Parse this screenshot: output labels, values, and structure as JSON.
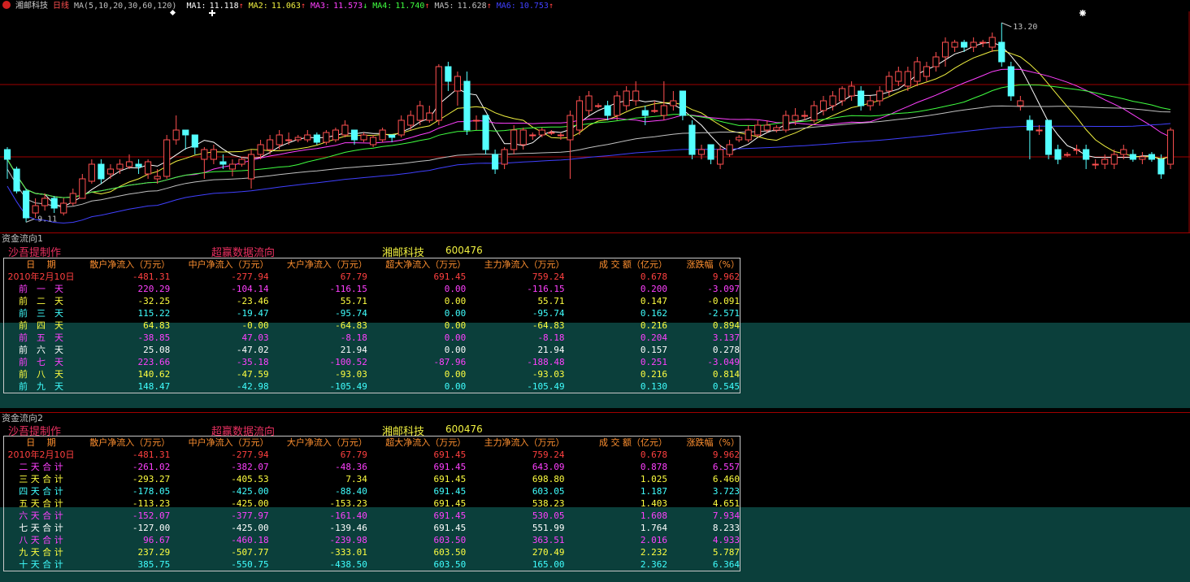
{
  "header": {
    "stock_name": "湘邮科技",
    "period": "日线",
    "ma_params": "MA(5,10,20,30,60,120)",
    "ma": [
      {
        "label": "MA1:",
        "value": "11.118",
        "arrow": "↑",
        "color": "#ffffff"
      },
      {
        "label": "MA2:",
        "value": "11.063",
        "arrow": "↑",
        "color": "#f0f040"
      },
      {
        "label": "MA3:",
        "value": "11.573",
        "arrow": "↓",
        "color": "#ff40ff"
      },
      {
        "label": "MA4:",
        "value": "11.740",
        "arrow": "↑",
        "color": "#40ff40"
      },
      {
        "label": "MA5:",
        "value": "11.628",
        "arrow": "↑",
        "color": "#c0c0c0"
      },
      {
        "label": "MA6:",
        "value": "10.753",
        "arrow": "↑",
        "color": "#4040ff"
      }
    ]
  },
  "chart": {
    "high_label": "13.20",
    "low_label": "9.11",
    "colors": {
      "up": "#ff5050",
      "down": "#54ffff",
      "grid": "#a00000"
    }
  },
  "chart_data": {
    "type": "candlestick",
    "ylim": [
      9.0,
      13.3
    ],
    "high": 13.2,
    "low": 9.11,
    "candles": [
      [
        10.6,
        10.4,
        10.65,
        10.0
      ],
      [
        10.2,
        9.75,
        10.25,
        9.7
      ],
      [
        9.75,
        9.2,
        9.8,
        9.11
      ],
      [
        9.3,
        9.45,
        9.6,
        9.2
      ],
      [
        9.45,
        9.6,
        9.7,
        9.35
      ],
      [
        9.6,
        9.4,
        9.65,
        9.3
      ],
      [
        9.3,
        9.5,
        9.6,
        9.25
      ],
      [
        9.5,
        9.7,
        9.8,
        9.45
      ],
      [
        9.6,
        10.0,
        10.1,
        9.6
      ],
      [
        9.95,
        10.3,
        10.4,
        9.9
      ],
      [
        10.3,
        10.0,
        10.4,
        9.9
      ],
      [
        10.1,
        10.2,
        10.3,
        10.0
      ],
      [
        10.2,
        10.3,
        10.4,
        10.1
      ],
      [
        10.25,
        10.35,
        10.5,
        10.2
      ],
      [
        10.3,
        10.25,
        10.4,
        10.1
      ],
      [
        10.1,
        10.35,
        10.4,
        10.0
      ],
      [
        10.0,
        10.05,
        10.2,
        9.9
      ],
      [
        10.05,
        10.8,
        10.9,
        10.0
      ],
      [
        10.8,
        11.0,
        11.3,
        10.7
      ],
      [
        11.0,
        10.9,
        11.0,
        10.6
      ],
      [
        10.9,
        10.65,
        10.9,
        10.5
      ],
      [
        10.4,
        10.6,
        10.65,
        10.0
      ],
      [
        10.4,
        10.6,
        10.7,
        10.3
      ],
      [
        10.35,
        10.3,
        10.5,
        10.2
      ],
      [
        10.2,
        10.3,
        10.4,
        10.05
      ],
      [
        10.3,
        10.4,
        10.45,
        10.25
      ],
      [
        10.0,
        10.5,
        10.6,
        9.8
      ],
      [
        10.5,
        10.7,
        10.8,
        10.4
      ],
      [
        10.6,
        10.8,
        10.9,
        10.5
      ],
      [
        10.7,
        10.9,
        11.0,
        10.6
      ],
      [
        10.8,
        10.8,
        10.95,
        10.7
      ],
      [
        10.8,
        10.85,
        10.9,
        10.75
      ],
      [
        10.8,
        10.9,
        11.0,
        10.75
      ],
      [
        10.9,
        10.75,
        10.95,
        10.7
      ],
      [
        10.75,
        10.95,
        11.0,
        10.7
      ],
      [
        10.8,
        11.0,
        11.05,
        10.75
      ],
      [
        10.9,
        11.1,
        11.2,
        10.85
      ],
      [
        11.0,
        10.8,
        11.0,
        10.7
      ],
      [
        10.8,
        10.9,
        10.95,
        10.75
      ],
      [
        10.7,
        10.85,
        10.9,
        10.65
      ],
      [
        10.8,
        11.0,
        11.05,
        10.75
      ],
      [
        10.9,
        10.85,
        10.9,
        10.75
      ],
      [
        10.9,
        11.2,
        11.3,
        10.85
      ],
      [
        11.1,
        11.3,
        11.4,
        11.0
      ],
      [
        11.2,
        11.5,
        11.6,
        11.1
      ],
      [
        11.2,
        11.35,
        11.5,
        11.15
      ],
      [
        11.2,
        12.3,
        12.35,
        11.1
      ],
      [
        12.3,
        12.0,
        12.4,
        11.8
      ],
      [
        11.8,
        12.1,
        12.2,
        11.5
      ],
      [
        12.0,
        11.0,
        12.2,
        10.9
      ],
      [
        11.2,
        11.2,
        11.3,
        11.0
      ],
      [
        11.3,
        10.6,
        11.3,
        10.5
      ],
      [
        10.5,
        10.2,
        10.6,
        10.1
      ],
      [
        10.3,
        10.6,
        10.65,
        10.2
      ],
      [
        10.6,
        11.0,
        11.1,
        10.5
      ],
      [
        10.7,
        11.0,
        11.05,
        10.6
      ],
      [
        10.9,
        10.9,
        10.95,
        10.8
      ],
      [
        10.9,
        11.0,
        11.05,
        10.85
      ],
      [
        10.95,
        10.95,
        11.0,
        10.9
      ],
      [
        10.9,
        10.9,
        10.95,
        10.8
      ],
      [
        10.8,
        11.3,
        11.4,
        10.0
      ],
      [
        11.0,
        11.6,
        11.7,
        10.9
      ],
      [
        11.4,
        11.7,
        11.8,
        11.3
      ],
      [
        11.5,
        11.5,
        11.55,
        11.45
      ],
      [
        11.5,
        11.3,
        11.6,
        11.2
      ],
      [
        11.3,
        11.7,
        11.8,
        11.2
      ],
      [
        11.5,
        11.8,
        11.9,
        11.4
      ],
      [
        11.6,
        11.8,
        12.0,
        11.5
      ],
      [
        11.4,
        11.3,
        11.5,
        11.1
      ],
      [
        11.4,
        11.4,
        11.6,
        11.35
      ],
      [
        11.3,
        11.5,
        12.0,
        11.2
      ],
      [
        11.5,
        11.6,
        11.8,
        11.4
      ],
      [
        11.8,
        11.3,
        11.8,
        11.2
      ],
      [
        11.1,
        10.5,
        11.2,
        10.4
      ],
      [
        10.5,
        10.6,
        10.7,
        10.4
      ],
      [
        10.7,
        10.4,
        10.7,
        10.3
      ],
      [
        10.3,
        10.6,
        10.7,
        10.2
      ],
      [
        10.5,
        10.7,
        10.8,
        10.45
      ],
      [
        10.8,
        10.85,
        10.9,
        10.75
      ],
      [
        10.8,
        11.0,
        11.1,
        10.75
      ],
      [
        10.9,
        11.1,
        11.2,
        10.85
      ],
      [
        11.0,
        11.1,
        11.2,
        10.95
      ],
      [
        11.0,
        11.05,
        11.1,
        10.95
      ],
      [
        11.0,
        11.3,
        11.4,
        10.95
      ],
      [
        11.2,
        11.3,
        11.45,
        11.1
      ],
      [
        11.3,
        11.3,
        11.4,
        11.2
      ],
      [
        11.2,
        11.5,
        11.6,
        11.15
      ],
      [
        11.4,
        11.6,
        11.7,
        11.3
      ],
      [
        11.5,
        11.7,
        11.8,
        11.4
      ],
      [
        11.6,
        11.85,
        11.9,
        11.5
      ],
      [
        11.7,
        11.9,
        12.0,
        11.6
      ],
      [
        11.8,
        11.5,
        11.9,
        11.4
      ],
      [
        11.5,
        11.6,
        11.7,
        11.4
      ],
      [
        11.6,
        11.8,
        11.9,
        11.5
      ],
      [
        11.8,
        12.1,
        12.2,
        11.7
      ],
      [
        12.0,
        12.2,
        12.3,
        11.9
      ],
      [
        11.9,
        12.2,
        12.3,
        11.8
      ],
      [
        12.0,
        12.4,
        12.5,
        11.9
      ],
      [
        12.1,
        12.3,
        12.4,
        12.0
      ],
      [
        12.3,
        12.5,
        12.6,
        12.2
      ],
      [
        12.5,
        12.8,
        12.9,
        12.3
      ],
      [
        12.7,
        12.8,
        12.85,
        12.6
      ],
      [
        12.8,
        12.7,
        12.85,
        12.6
      ],
      [
        12.7,
        12.8,
        12.9,
        12.6
      ],
      [
        12.8,
        12.8,
        12.85,
        12.7
      ],
      [
        12.7,
        12.9,
        13.0,
        12.6
      ],
      [
        12.8,
        12.4,
        13.2,
        12.3
      ],
      [
        12.3,
        11.7,
        12.4,
        11.6
      ],
      [
        11.5,
        11.6,
        11.7,
        11.4
      ],
      [
        11.2,
        11.0,
        11.3,
        10.4
      ],
      [
        11.0,
        11.0,
        11.1,
        10.9
      ],
      [
        11.2,
        10.5,
        11.2,
        10.4
      ],
      [
        10.6,
        10.4,
        10.7,
        10.3
      ],
      [
        10.5,
        10.5,
        10.55,
        10.45
      ],
      [
        10.6,
        10.6,
        10.7,
        10.5
      ],
      [
        10.6,
        10.4,
        10.7,
        10.2
      ],
      [
        10.3,
        10.3,
        10.4,
        10.2
      ],
      [
        10.3,
        10.4,
        10.5,
        10.2
      ],
      [
        10.3,
        10.5,
        10.6,
        10.2
      ],
      [
        10.5,
        10.6,
        10.7,
        10.4
      ],
      [
        10.5,
        10.4,
        10.6,
        10.35
      ],
      [
        10.4,
        10.45,
        10.55,
        10.3
      ],
      [
        10.5,
        10.4,
        10.55,
        10.35
      ],
      [
        10.4,
        10.1,
        10.5,
        10.0
      ],
      [
        10.3,
        11.0,
        11.05,
        10.2
      ]
    ]
  },
  "panel1": {
    "title": "资金流向1",
    "author": "沙吾提制作",
    "heading": "超赢数据流向",
    "stock_label": "湘邮科技",
    "stock_code": "600476",
    "columns": [
      "日　 期",
      "散户净流入（万元）",
      "中户净流入（万元）",
      "大户净流入（万元）",
      "超大净流入（万元）",
      "主力净流入（万元）",
      "成 交 额（亿元）",
      "涨跌幅（%）"
    ],
    "rows": [
      {
        "color": "#ff4040",
        "cells": [
          "2010年2月10日",
          "-481.31",
          "-277.94",
          "67.79",
          "691.45",
          "759.24",
          "0.678",
          "9.962"
        ]
      },
      {
        "color": "#ff40ff",
        "cells": [
          "前　一　天",
          "220.29",
          "-104.14",
          "-116.15",
          "0.00",
          "-116.15",
          "0.200",
          "-3.097"
        ]
      },
      {
        "color": "#ffff40",
        "cells": [
          "前　二　天",
          "-32.25",
          "-23.46",
          "55.71",
          "0.00",
          "55.71",
          "0.147",
          "-0.091"
        ]
      },
      {
        "color": "#40ffff",
        "cells": [
          "前　三　天",
          "115.22",
          "-19.47",
          "-95.74",
          "0.00",
          "-95.74",
          "0.162",
          "-2.571"
        ]
      },
      {
        "color": "#ffff40",
        "cells": [
          "前　四　天",
          "64.83",
          "-0.00",
          "-64.83",
          "0.00",
          "-64.83",
          "0.216",
          "0.894"
        ]
      },
      {
        "color": "#ff40ff",
        "cells": [
          "前　五　天",
          "-38.85",
          "47.03",
          "-8.18",
          "0.00",
          "-8.18",
          "0.204",
          "3.137"
        ]
      },
      {
        "color": "#ffffff",
        "cells": [
          "前　六　天",
          "25.08",
          "-47.02",
          "21.94",
          "0.00",
          "21.94",
          "0.157",
          "0.278"
        ]
      },
      {
        "color": "#ff40ff",
        "cells": [
          "前　七　天",
          "223.66",
          "-35.18",
          "-100.52",
          "-87.96",
          "-188.48",
          "0.251",
          "-3.049"
        ]
      },
      {
        "color": "#ffff40",
        "cells": [
          "前　八　天",
          "140.62",
          "-47.59",
          "-93.03",
          "0.00",
          "-93.03",
          "0.216",
          "0.814"
        ]
      },
      {
        "color": "#40ffff",
        "cells": [
          "前　九　天",
          "148.47",
          "-42.98",
          "-105.49",
          "0.00",
          "-105.49",
          "0.130",
          "0.545"
        ]
      }
    ]
  },
  "panel2": {
    "title": "资金流向2",
    "author": "沙吾提制作",
    "heading": "超赢数据流向",
    "stock_label": "湘邮科技",
    "stock_code": "600476",
    "columns": [
      "日　 期",
      "散户净流入（万元）",
      "中户净流入（万元）",
      "大户净流入（万元）",
      "超大净流入（万元）",
      "主力净流入（万元）",
      "成 交 额（亿元）",
      "涨跌幅（%）"
    ],
    "rows": [
      {
        "color": "#ff4040",
        "cells": [
          "2010年2月10日",
          "-481.31",
          "-277.94",
          "67.79",
          "691.45",
          "759.24",
          "0.678",
          "9.962"
        ]
      },
      {
        "color": "#ff40ff",
        "cells": [
          "二 天 合 计",
          "-261.02",
          "-382.07",
          "-48.36",
          "691.45",
          "643.09",
          "0.878",
          "6.557"
        ]
      },
      {
        "color": "#ffff40",
        "cells": [
          "三 天 合 计",
          "-293.27",
          "-405.53",
          "7.34",
          "691.45",
          "698.80",
          "1.025",
          "6.460"
        ]
      },
      {
        "color": "#40ffff",
        "cells": [
          "四 天 合 计",
          "-178.05",
          "-425.00",
          "-88.40",
          "691.45",
          "603.05",
          "1.187",
          "3.723"
        ]
      },
      {
        "color": "#ffff40",
        "cells": [
          "五 天 合 计",
          "-113.23",
          "-425.00",
          "-153.23",
          "691.45",
          "538.23",
          "1.403",
          "4.651"
        ]
      },
      {
        "color": "#ff40ff",
        "cells": [
          "六 天 合 计",
          "-152.07",
          "-377.97",
          "-161.40",
          "691.45",
          "530.05",
          "1.608",
          "7.934"
        ]
      },
      {
        "color": "#ffffff",
        "cells": [
          "七 天 合 计",
          "-127.00",
          "-425.00",
          "-139.46",
          "691.45",
          "551.99",
          "1.764",
          "8.233"
        ]
      },
      {
        "color": "#ff40ff",
        "cells": [
          "八 天 合 计",
          "96.67",
          "-460.18",
          "-239.98",
          "603.50",
          "363.51",
          "2.016",
          "4.933"
        ]
      },
      {
        "color": "#ffff40",
        "cells": [
          "九 天 合 计",
          "237.29",
          "-507.77",
          "-333.01",
          "603.50",
          "270.49",
          "2.232",
          "5.787"
        ]
      },
      {
        "color": "#40ffff",
        "cells": [
          "十 天 合 计",
          "385.75",
          "-550.75",
          "-438.50",
          "603.50",
          "165.00",
          "2.362",
          "6.364"
        ]
      }
    ]
  }
}
